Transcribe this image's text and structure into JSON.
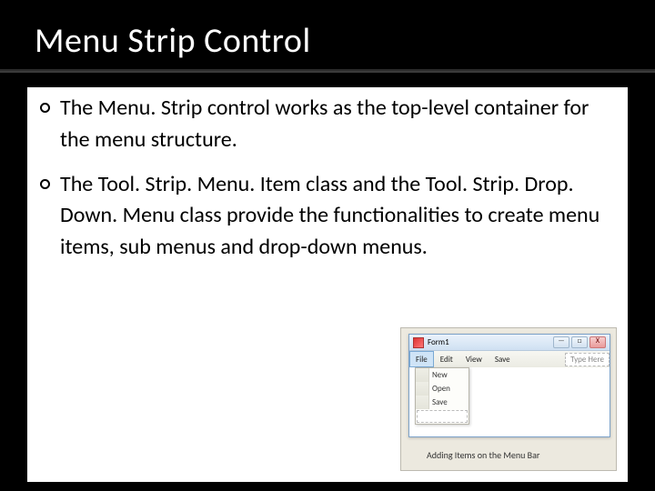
{
  "slide": {
    "title": "Menu Strip Control",
    "bullets": [
      "The Menu. Strip control works as the top-level container for the menu structure.",
      "The Tool. Strip. Menu. Item class and the Tool. Strip. Drop. Down. Menu class provide the functionalities to create menu items, sub menus and drop-down menus."
    ]
  },
  "figure": {
    "window_title": "Form1",
    "window_buttons": {
      "min": "—",
      "max": "□",
      "close": "X"
    },
    "menu_items": [
      "File",
      "Edit",
      "View",
      "Save"
    ],
    "menu_typehere": "Type Here",
    "selected_menu": "File",
    "dropdown_items": [
      "New",
      "Open",
      "Save"
    ],
    "caption": "Adding Items on the Menu Bar"
  }
}
